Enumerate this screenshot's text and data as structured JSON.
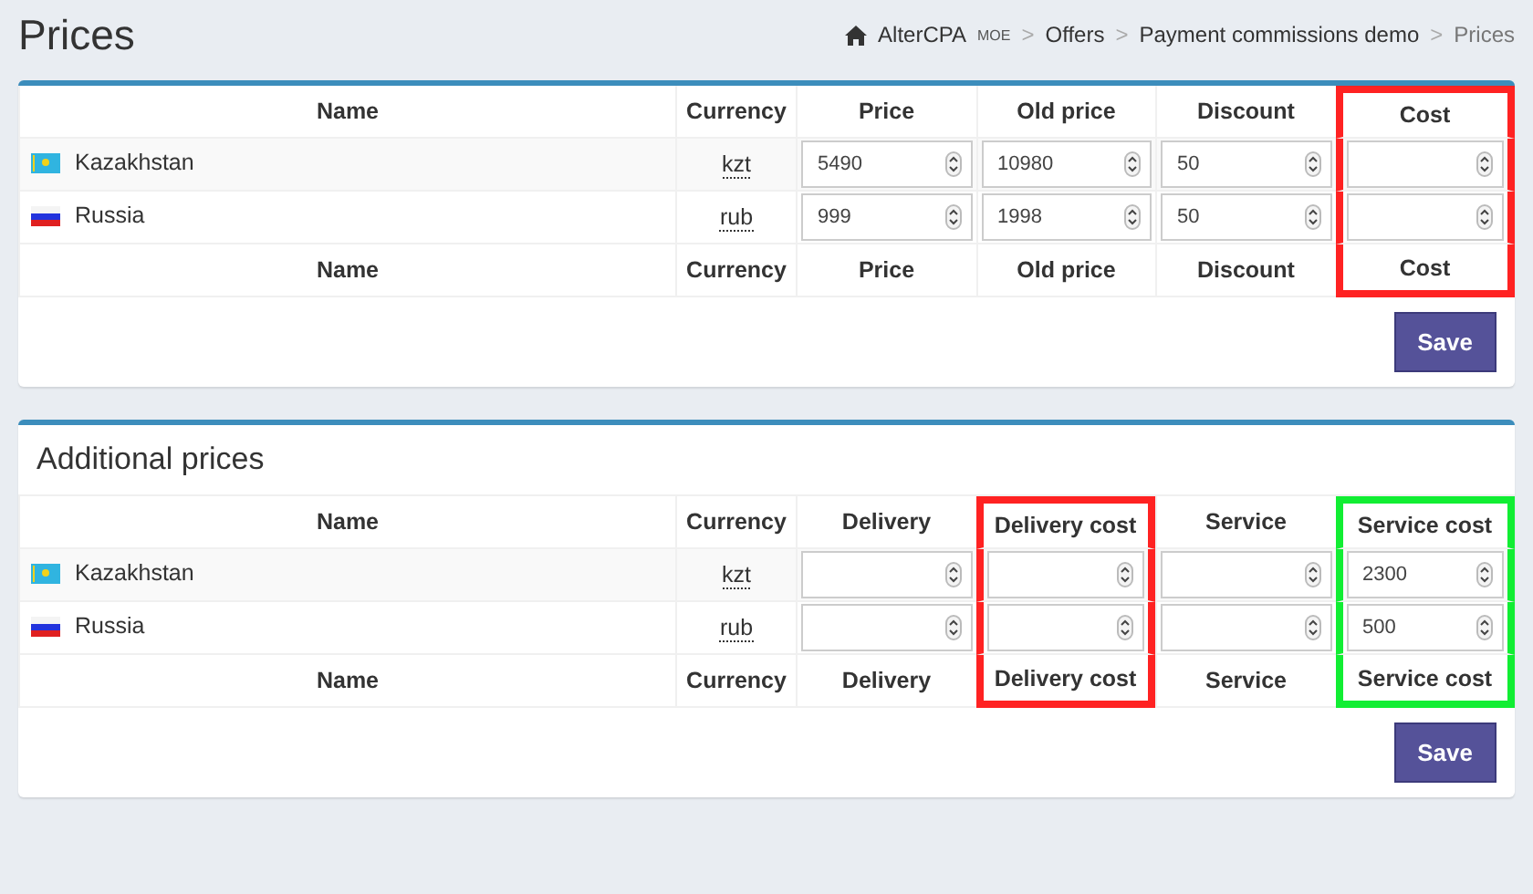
{
  "page_title": "Prices",
  "breadcrumb": [
    {
      "kind": "home",
      "label": "AlterCPA",
      "tag": "MOE"
    },
    {
      "kind": "sep",
      "label": ">"
    },
    {
      "kind": "link",
      "label": "Offers"
    },
    {
      "kind": "sep",
      "label": ">"
    },
    {
      "kind": "link",
      "label": "Payment commissions demo"
    },
    {
      "kind": "sep",
      "label": ">"
    },
    {
      "kind": "current",
      "label": "Prices"
    }
  ],
  "panels": [
    {
      "columns": [
        {
          "label": "Name"
        },
        {
          "label": "Currency"
        },
        {
          "label": "Price"
        },
        {
          "label": "Old price"
        },
        {
          "label": "Discount"
        },
        {
          "label": "Cost",
          "color": "#ff2222"
        }
      ],
      "rows": [
        {
          "kind": "kz",
          "name": "Kazakhstan",
          "currency": "kzt",
          "fields": [
            {
              "kind": "number",
              "value": "5490"
            },
            {
              "kind": "number",
              "value": "10980"
            },
            {
              "kind": "number",
              "value": "50"
            },
            {
              "kind": "number"
            }
          ]
        },
        {
          "kind": "ru",
          "name": "Russia",
          "currency": "rub",
          "fields": [
            {
              "kind": "number",
              "value": "999"
            },
            {
              "kind": "number",
              "value": "1998"
            },
            {
              "kind": "number",
              "value": "50"
            },
            {
              "kind": "number"
            }
          ]
        }
      ],
      "footer_columns": [
        "Name",
        "Currency",
        "Price",
        "Old price",
        "Discount",
        "Cost"
      ],
      "save_button": "Save"
    },
    {
      "title": "Additional prices",
      "columns": [
        {
          "label": "Name"
        },
        {
          "label": "Currency"
        },
        {
          "label": "Delivery"
        },
        {
          "label": "Delivery cost",
          "color": "#ff2222"
        },
        {
          "label": "Service"
        },
        {
          "label": "Service cost",
          "color": "#11ee33"
        }
      ],
      "rows": [
        {
          "kind": "kz",
          "name": "Kazakhstan",
          "currency": "kzt",
          "fields": [
            {
              "kind": "number"
            },
            {
              "kind": "number"
            },
            {
              "kind": "number"
            },
            {
              "kind": "number",
              "value": "2300"
            }
          ]
        },
        {
          "kind": "ru",
          "name": "Russia",
          "currency": "rub",
          "fields": [
            {
              "kind": "number"
            },
            {
              "kind": "number"
            },
            {
              "kind": "number"
            },
            {
              "kind": "number",
              "value": "500"
            }
          ]
        }
      ],
      "footer_columns": [
        "Name",
        "Currency",
        "Delivery",
        "Delivery cost",
        "Service",
        "Service cost"
      ],
      "save_button": "Save"
    }
  ]
}
